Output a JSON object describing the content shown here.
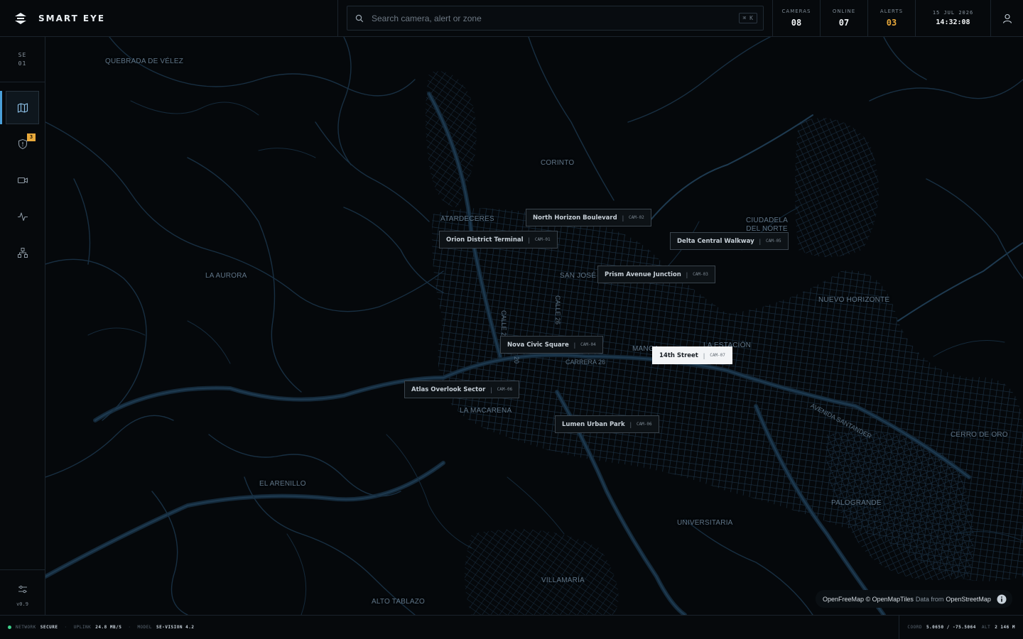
{
  "app": {
    "name": "SMART EYE"
  },
  "search": {
    "placeholder": "Search camera, alert or zone",
    "shortcut": "⌘ K"
  },
  "stats": [
    {
      "label": "CAMERAS",
      "value": "08",
      "tone": "normal"
    },
    {
      "label": "ONLINE",
      "value": "07",
      "tone": "normal"
    },
    {
      "label": "ALERTS",
      "value": "03",
      "tone": "alert"
    }
  ],
  "clock": {
    "date": "15 JUL 2026",
    "time": "14:32:08"
  },
  "sidebar": {
    "code_line1": "SE",
    "code_line2": "01",
    "items": [
      {
        "name": "map",
        "icon": "map-icon",
        "active": true
      },
      {
        "name": "alerts",
        "icon": "shield-alert-icon",
        "badge": "3"
      },
      {
        "name": "cameras",
        "icon": "video-camera-icon"
      },
      {
        "name": "analytics",
        "icon": "pulse-icon"
      },
      {
        "name": "network",
        "icon": "hierarchy-icon"
      }
    ],
    "settings_icon": "sliders-icon",
    "version": "v0.9"
  },
  "map": {
    "places": {
      "quebrada": "QUEBRADA DE VÉLEZ",
      "corinto": "CORINTO",
      "atardeceres": "ATARDECERES",
      "ciudadela_1": "CIUDADELA",
      "ciudadela_2": "DEL NORTE",
      "la_aurora": "LA AURORA",
      "san_jose": "SAN JOSÉ",
      "nuevo_horizonte": "NUEVO HORIZONTE",
      "la_estacion": "LA ESTACIÓN",
      "manga": "MANGA",
      "la_macarena": "LA MACARENA",
      "cerro_de_oro": "CERRO DE ORO",
      "el_arenillo": "EL ARENILLO",
      "palogrande": "PALOGRANDE",
      "universitaria": "UNIVERSITARIA",
      "villamaria": "VILLAMARÍA",
      "alto_tablazo": "ALTO TABLAZO"
    },
    "streets": {
      "calle21": "CALLE 21",
      "calle26": "CALLE 26",
      "carrera26": "CARRERA 26",
      "carrera20": "20",
      "avenida": "AVENIDA SANTANDER"
    },
    "cameras": [
      {
        "name": "North Horizon Boulevard",
        "id": "CAM-02"
      },
      {
        "name": "Orion District Terminal",
        "id": "CAM-01"
      },
      {
        "name": "Delta Central Walkway",
        "id": "CAM-05"
      },
      {
        "name": "Prism Avenue Junction",
        "id": "CAM-03"
      },
      {
        "name": "Nova Civic Square",
        "id": "CAM-04"
      },
      {
        "name": "14th Street",
        "id": "CAM-07",
        "active": true
      },
      {
        "name": "Atlas Overlook Sector",
        "id": "CAM-06"
      },
      {
        "name": "Lumen Urban Park",
        "id": "CAM-06"
      }
    ],
    "attribution": {
      "part1": "OpenFreeMap © OpenMapTiles",
      "part2": "Data from",
      "part3": "OpenStreetMap"
    }
  },
  "status": {
    "network_label": "NETWORK",
    "network_value": "SECURE",
    "uplink_label": "UPLINK",
    "uplink_value": "24.8 MB/S",
    "model_label": "MODEL",
    "model_value": "SE-VISION 4.2",
    "coord_label": "COORD",
    "coord_value": "5.0650 / -75.5064",
    "alt_label": "ALT",
    "alt_value": "2 146 M"
  }
}
